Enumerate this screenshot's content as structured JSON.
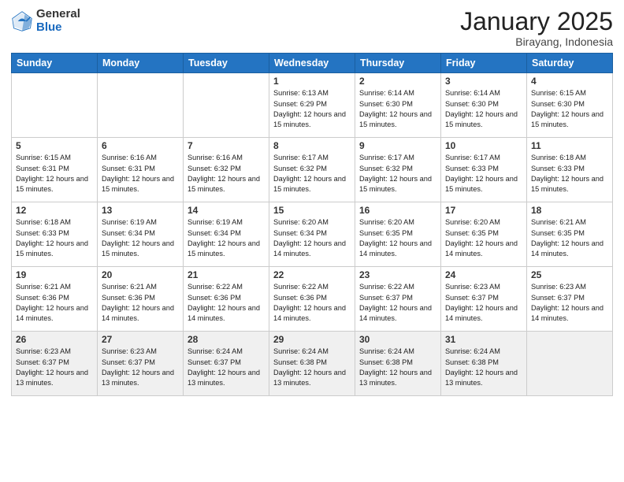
{
  "header": {
    "logo_general": "General",
    "logo_blue": "Blue",
    "month": "January 2025",
    "location": "Birayang, Indonesia"
  },
  "weekdays": [
    "Sunday",
    "Monday",
    "Tuesday",
    "Wednesday",
    "Thursday",
    "Friday",
    "Saturday"
  ],
  "weeks": [
    [
      {
        "day": "",
        "info": ""
      },
      {
        "day": "",
        "info": ""
      },
      {
        "day": "",
        "info": ""
      },
      {
        "day": "1",
        "info": "Sunrise: 6:13 AM\nSunset: 6:29 PM\nDaylight: 12 hours\nand 15 minutes."
      },
      {
        "day": "2",
        "info": "Sunrise: 6:14 AM\nSunset: 6:30 PM\nDaylight: 12 hours\nand 15 minutes."
      },
      {
        "day": "3",
        "info": "Sunrise: 6:14 AM\nSunset: 6:30 PM\nDaylight: 12 hours\nand 15 minutes."
      },
      {
        "day": "4",
        "info": "Sunrise: 6:15 AM\nSunset: 6:30 PM\nDaylight: 12 hours\nand 15 minutes."
      }
    ],
    [
      {
        "day": "5",
        "info": "Sunrise: 6:15 AM\nSunset: 6:31 PM\nDaylight: 12 hours\nand 15 minutes."
      },
      {
        "day": "6",
        "info": "Sunrise: 6:16 AM\nSunset: 6:31 PM\nDaylight: 12 hours\nand 15 minutes."
      },
      {
        "day": "7",
        "info": "Sunrise: 6:16 AM\nSunset: 6:32 PM\nDaylight: 12 hours\nand 15 minutes."
      },
      {
        "day": "8",
        "info": "Sunrise: 6:17 AM\nSunset: 6:32 PM\nDaylight: 12 hours\nand 15 minutes."
      },
      {
        "day": "9",
        "info": "Sunrise: 6:17 AM\nSunset: 6:32 PM\nDaylight: 12 hours\nand 15 minutes."
      },
      {
        "day": "10",
        "info": "Sunrise: 6:17 AM\nSunset: 6:33 PM\nDaylight: 12 hours\nand 15 minutes."
      },
      {
        "day": "11",
        "info": "Sunrise: 6:18 AM\nSunset: 6:33 PM\nDaylight: 12 hours\nand 15 minutes."
      }
    ],
    [
      {
        "day": "12",
        "info": "Sunrise: 6:18 AM\nSunset: 6:33 PM\nDaylight: 12 hours\nand 15 minutes."
      },
      {
        "day": "13",
        "info": "Sunrise: 6:19 AM\nSunset: 6:34 PM\nDaylight: 12 hours\nand 15 minutes."
      },
      {
        "day": "14",
        "info": "Sunrise: 6:19 AM\nSunset: 6:34 PM\nDaylight: 12 hours\nand 15 minutes."
      },
      {
        "day": "15",
        "info": "Sunrise: 6:20 AM\nSunset: 6:34 PM\nDaylight: 12 hours\nand 14 minutes."
      },
      {
        "day": "16",
        "info": "Sunrise: 6:20 AM\nSunset: 6:35 PM\nDaylight: 12 hours\nand 14 minutes."
      },
      {
        "day": "17",
        "info": "Sunrise: 6:20 AM\nSunset: 6:35 PM\nDaylight: 12 hours\nand 14 minutes."
      },
      {
        "day": "18",
        "info": "Sunrise: 6:21 AM\nSunset: 6:35 PM\nDaylight: 12 hours\nand 14 minutes."
      }
    ],
    [
      {
        "day": "19",
        "info": "Sunrise: 6:21 AM\nSunset: 6:36 PM\nDaylight: 12 hours\nand 14 minutes."
      },
      {
        "day": "20",
        "info": "Sunrise: 6:21 AM\nSunset: 6:36 PM\nDaylight: 12 hours\nand 14 minutes."
      },
      {
        "day": "21",
        "info": "Sunrise: 6:22 AM\nSunset: 6:36 PM\nDaylight: 12 hours\nand 14 minutes."
      },
      {
        "day": "22",
        "info": "Sunrise: 6:22 AM\nSunset: 6:36 PM\nDaylight: 12 hours\nand 14 minutes."
      },
      {
        "day": "23",
        "info": "Sunrise: 6:22 AM\nSunset: 6:37 PM\nDaylight: 12 hours\nand 14 minutes."
      },
      {
        "day": "24",
        "info": "Sunrise: 6:23 AM\nSunset: 6:37 PM\nDaylight: 12 hours\nand 14 minutes."
      },
      {
        "day": "25",
        "info": "Sunrise: 6:23 AM\nSunset: 6:37 PM\nDaylight: 12 hours\nand 14 minutes."
      }
    ],
    [
      {
        "day": "26",
        "info": "Sunrise: 6:23 AM\nSunset: 6:37 PM\nDaylight: 12 hours\nand 13 minutes."
      },
      {
        "day": "27",
        "info": "Sunrise: 6:23 AM\nSunset: 6:37 PM\nDaylight: 12 hours\nand 13 minutes."
      },
      {
        "day": "28",
        "info": "Sunrise: 6:24 AM\nSunset: 6:37 PM\nDaylight: 12 hours\nand 13 minutes."
      },
      {
        "day": "29",
        "info": "Sunrise: 6:24 AM\nSunset: 6:38 PM\nDaylight: 12 hours\nand 13 minutes."
      },
      {
        "day": "30",
        "info": "Sunrise: 6:24 AM\nSunset: 6:38 PM\nDaylight: 12 hours\nand 13 minutes."
      },
      {
        "day": "31",
        "info": "Sunrise: 6:24 AM\nSunset: 6:38 PM\nDaylight: 12 hours\nand 13 minutes."
      },
      {
        "day": "",
        "info": ""
      }
    ]
  ]
}
